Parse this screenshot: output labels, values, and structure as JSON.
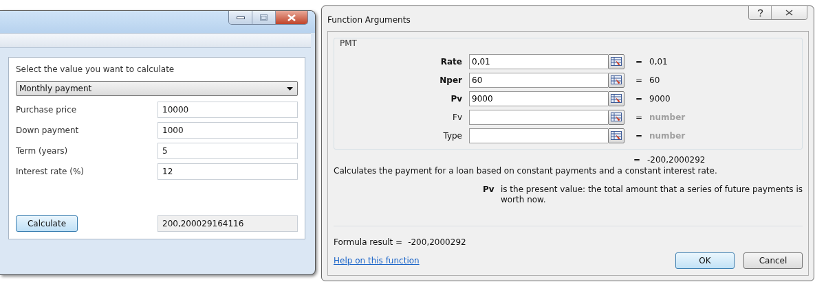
{
  "calculator_window": {
    "prompt": "Select the value you want to calculate",
    "calculation_type": "Monthly payment",
    "fields": [
      {
        "label": "Purchase price",
        "value": "10000"
      },
      {
        "label": "Down payment",
        "value": "1000"
      },
      {
        "label": "Term (years)",
        "value": "5"
      },
      {
        "label": "Interest rate (%)",
        "value": "12"
      }
    ],
    "calculate_button": "Calculate",
    "result": "200,200029164116"
  },
  "function_arguments": {
    "title": "Function Arguments",
    "function_name": "PMT",
    "arguments": [
      {
        "label": "Rate",
        "required": true,
        "value": "0,01",
        "result": "0,01",
        "result_muted": false
      },
      {
        "label": "Nper",
        "required": true,
        "value": "60",
        "result": "60",
        "result_muted": false
      },
      {
        "label": "Pv",
        "required": true,
        "value": "9000",
        "result": "9000",
        "result_muted": false
      },
      {
        "label": "Fv",
        "required": false,
        "result": "number",
        "result_muted": true
      },
      {
        "label": "Type",
        "required": false,
        "result": "number",
        "result_muted": true
      }
    ],
    "equals_sign": "=",
    "function_result": "-200,2000292",
    "description": "Calculates the payment for a loan based on constant payments and a constant interest rate.",
    "argument_help_name": "Pv",
    "argument_help": "is the present value: the total amount that a series of future payments is worth now.",
    "formula_result_label": "Formula result =",
    "formula_result": "-200,2000292",
    "help_link": "Help on this function",
    "buttons": [
      {
        "label": "OK",
        "default": true
      },
      {
        "label": "Cancel",
        "default": false
      }
    ]
  }
}
